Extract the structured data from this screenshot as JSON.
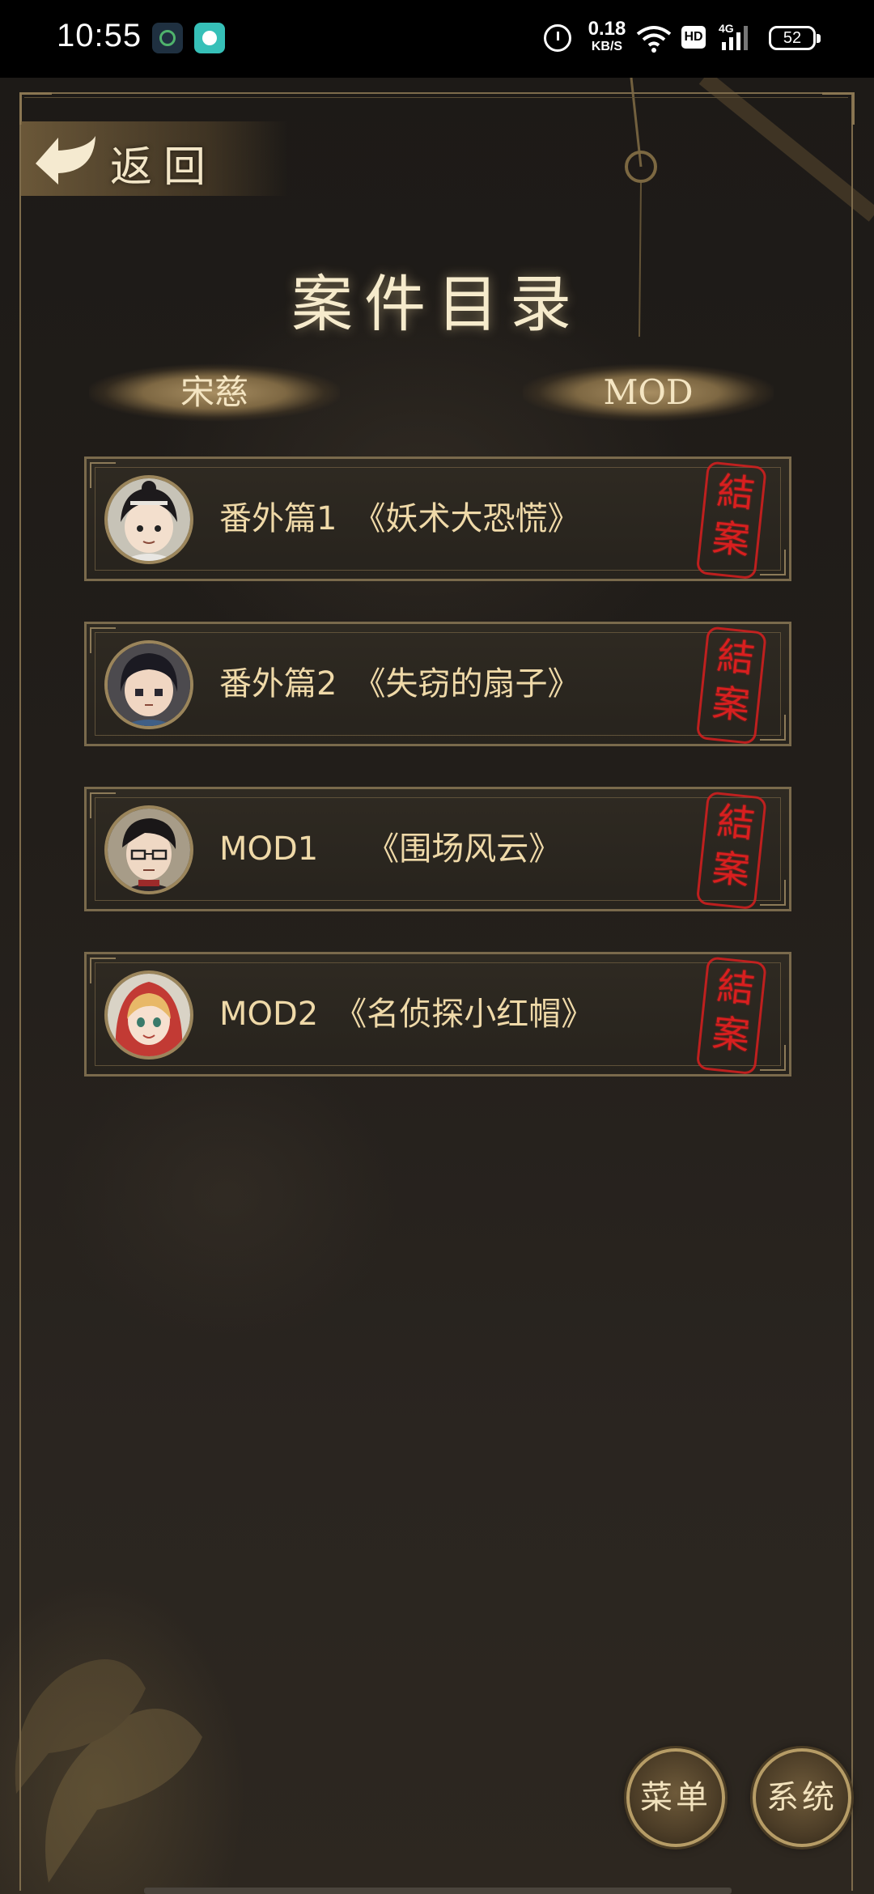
{
  "status_bar": {
    "time": "10:55",
    "net_speed_value": "0.18",
    "net_speed_unit": "KB/S",
    "hd": "HD",
    "network": "4G",
    "battery": "52"
  },
  "header": {
    "back_label": "返回",
    "title": "案件目录"
  },
  "tabs": [
    {
      "label": "宋慈"
    },
    {
      "label": "MOD"
    }
  ],
  "cases": [
    {
      "title": "番外篇1　《妖术大恐慌》",
      "stamp": "結案",
      "avatar": "avatar-boy-topknot"
    },
    {
      "title": "番外篇2　《失窃的扇子》",
      "stamp": "結案",
      "avatar": "avatar-boy-dark-hair"
    },
    {
      "title": "MOD1　　《围场风云》",
      "stamp": "結案",
      "avatar": "avatar-man-glasses"
    },
    {
      "title": "MOD2　《名侦探小红帽》",
      "stamp": "結案",
      "avatar": "avatar-girl-red-hood"
    }
  ],
  "bottom_buttons": {
    "menu": "菜单",
    "system": "系统"
  },
  "colors": {
    "accent_gold": "#efd9a8",
    "stamp_red": "#d81f1f",
    "frame": "#7a6a4c"
  }
}
